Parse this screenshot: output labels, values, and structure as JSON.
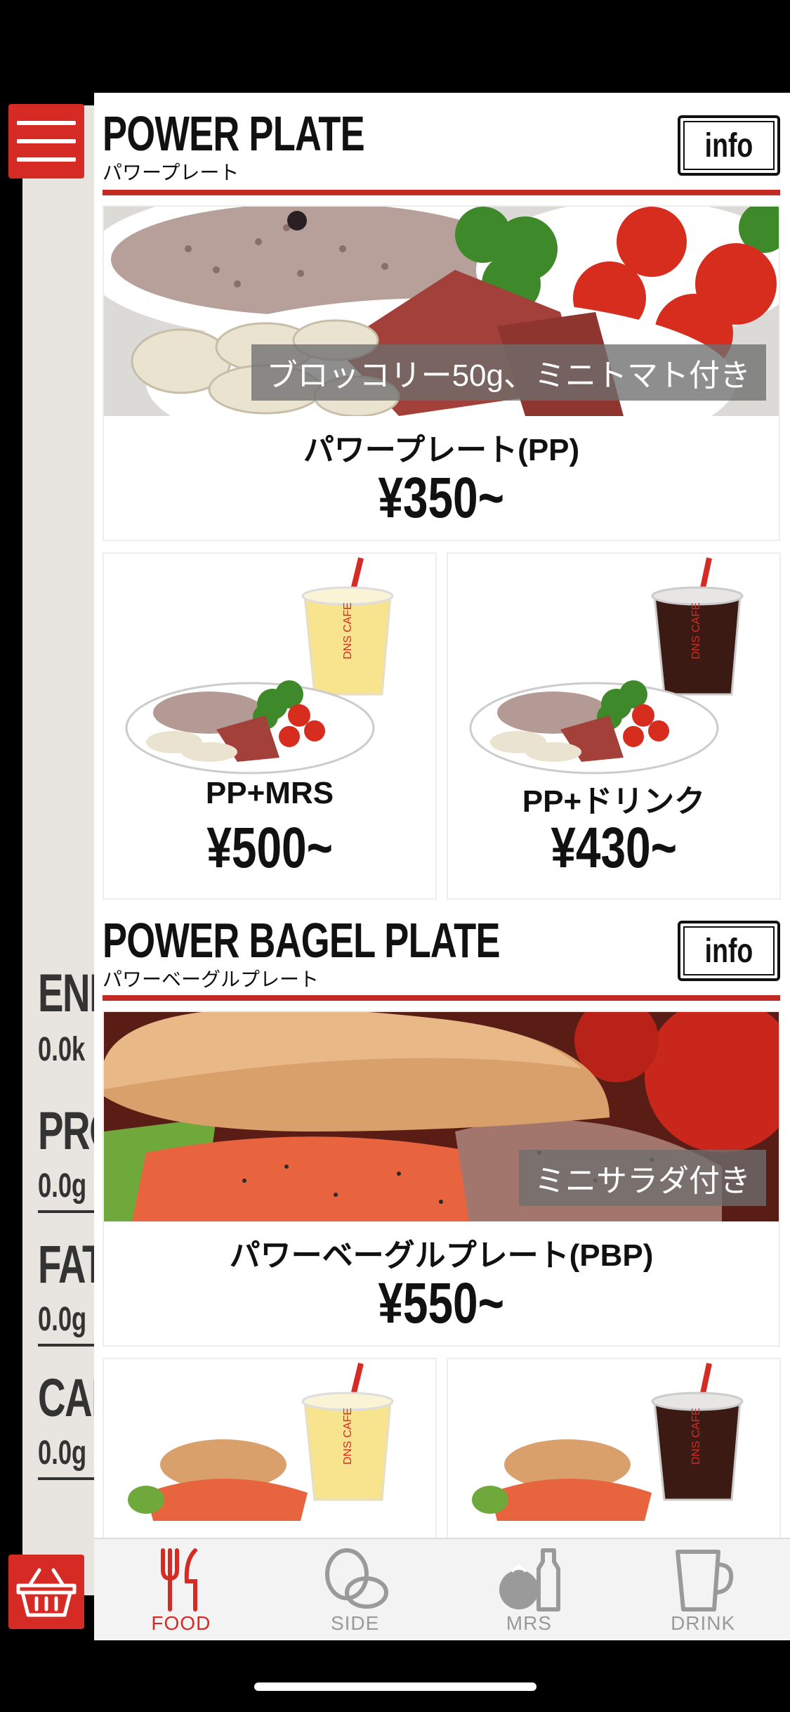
{
  "sections": [
    {
      "title": "POWER PLATE",
      "subtitle": "パワープレート",
      "info_label": "info",
      "hero": {
        "caption": "ブロッコリー50g、ミニトマト付き",
        "name": "パワープレート(PP)",
        "price": "¥350~"
      },
      "cards": [
        {
          "name": "PP+MRS",
          "price": "¥500~",
          "drink": "shake"
        },
        {
          "name": "PP+ドリンク",
          "price": "¥430~",
          "drink": "coffee"
        }
      ]
    },
    {
      "title": "POWER BAGEL PLATE",
      "subtitle": "パワーベーグルプレート",
      "info_label": "info",
      "hero": {
        "caption": "ミニサラダ付き",
        "name": "パワーベーグルプレート(PBP)",
        "price": "¥550~"
      },
      "cards": [
        {
          "drink": "shake"
        },
        {
          "drink": "coffee"
        }
      ]
    }
  ],
  "nutrition": {
    "energy": {
      "label": "ENE",
      "value": "0.0k"
    },
    "protein": {
      "label": "PRO",
      "value": "0.0g"
    },
    "fat": {
      "label": "FAT",
      "value": "0.0g"
    },
    "carb": {
      "label": "CAI",
      "value": "0.0g"
    }
  },
  "tabs": [
    {
      "label": "FOOD",
      "icon": "fork-knife-icon",
      "active": true
    },
    {
      "label": "SIDE",
      "icon": "egg-icon",
      "active": false
    },
    {
      "label": "MRS",
      "icon": "tomato-bottle-icon",
      "active": false
    },
    {
      "label": "DRINK",
      "icon": "mug-icon",
      "active": false
    }
  ],
  "colors": {
    "accent": "#d62b25",
    "rule": "#c42a24",
    "panel": "#e8e4df"
  }
}
